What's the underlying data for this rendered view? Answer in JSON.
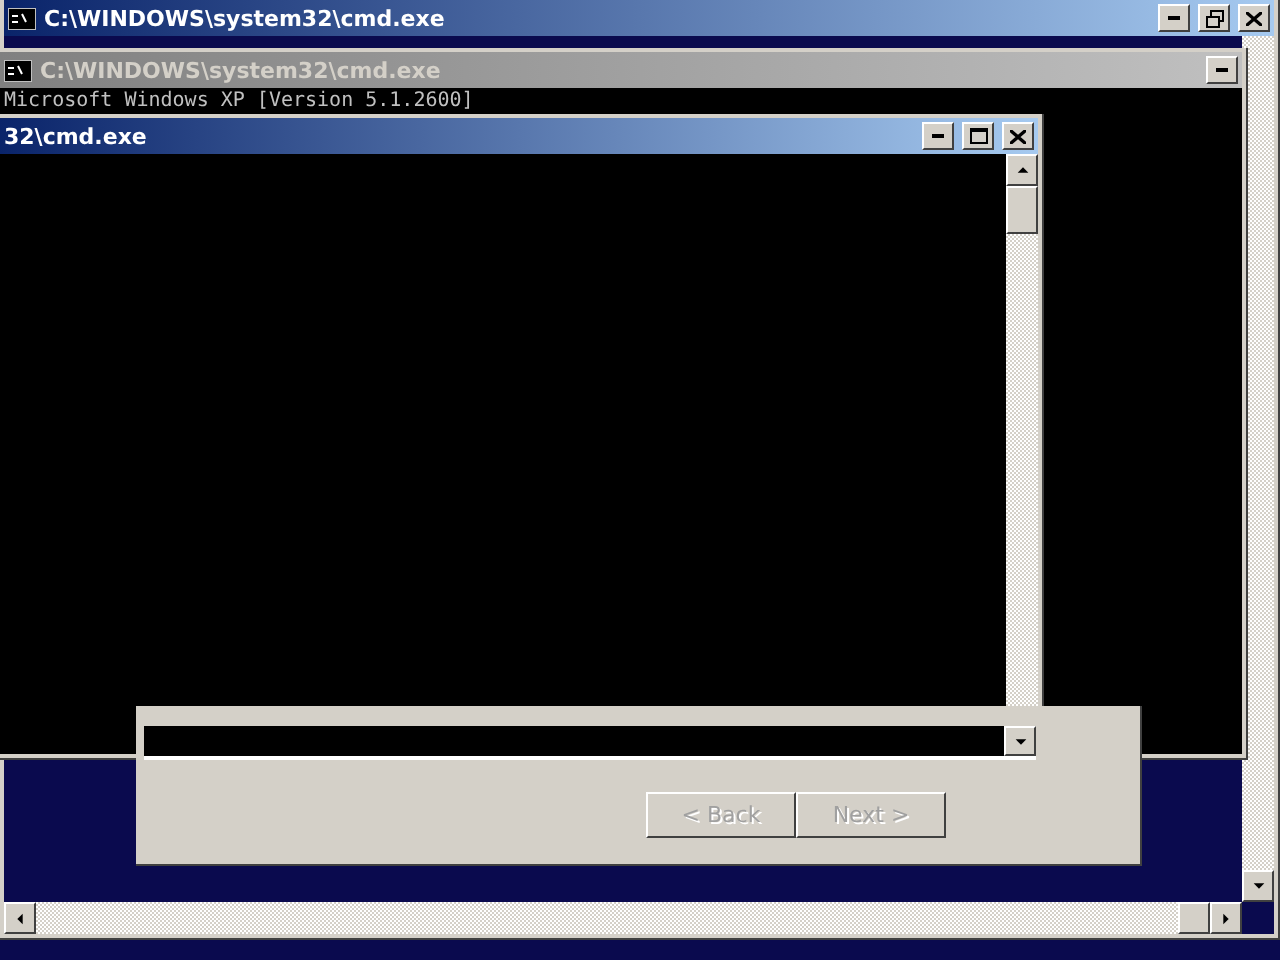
{
  "main_window": {
    "title": "C:\\WINDOWS\\system32\\cmd.exe",
    "active": true
  },
  "back_window": {
    "title": "C:\\WINDOWS\\system32\\cmd.exe",
    "active": false,
    "console_text": "Microsoft Windows XP [Version 5.1.2600]"
  },
  "front_window": {
    "title": "32\\cmd.exe",
    "active": true
  },
  "dialog": {
    "buttons": [
      {
        "label": "< Back",
        "disabled": true
      },
      {
        "label": "Next >",
        "disabled": true
      }
    ]
  }
}
